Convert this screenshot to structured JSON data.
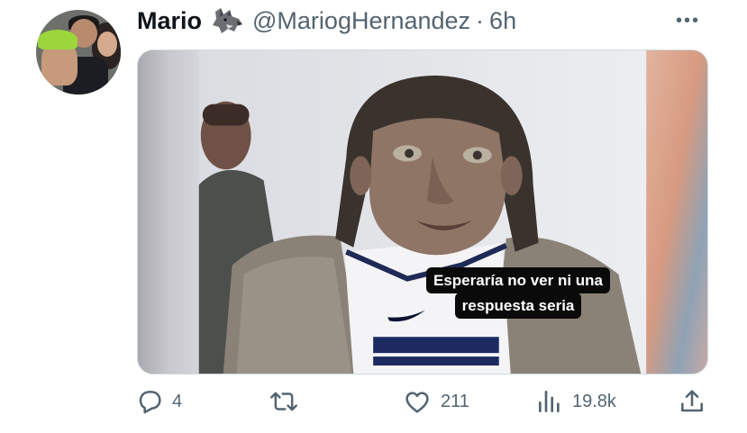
{
  "tweet": {
    "display_name": "Mario",
    "name_emoji": "wolf-emoji",
    "handle": "@MariogHernandez",
    "separator": "·",
    "time": "6h",
    "more_label": "•••"
  },
  "media": {
    "caption_line1": "Esperaría no ver ni una",
    "caption_line2": "respuesta seria"
  },
  "actions": {
    "replies": "4",
    "retweets": "",
    "likes": "211",
    "views": "19.8k"
  },
  "icons": [
    "reply-icon",
    "retweet-icon",
    "like-icon",
    "views-icon",
    "share-icon"
  ],
  "colors": {
    "text": "#0f1419",
    "secondary": "#536471",
    "border": "#cfd9de"
  }
}
